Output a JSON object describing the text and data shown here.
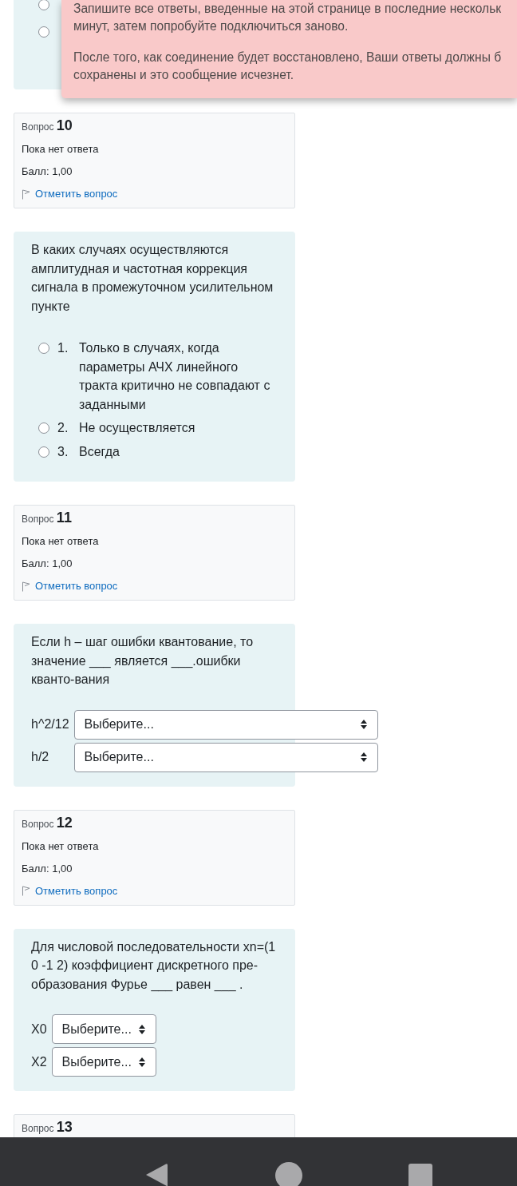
{
  "previous_question": {
    "options": [
      {
        "selected": false
      },
      {
        "selected": false
      }
    ]
  },
  "alert": {
    "paragraphs": [
      [
        "Запишите все ответы, введенные на этой странице в последние нескольк",
        "минут, затем попробуйте подключиться заново."
      ],
      [
        "После того, как соединение будет восстановлено, Ваши ответы должны б",
        "сохранены и это сообщение исчезнет."
      ]
    ]
  },
  "questions": [
    {
      "info": {
        "title": "Вопрос **10**",
        "status": "Пока нет ответа",
        "grade": "Балл: 1,00",
        "flag_link": "Отметить вопрос",
        "flagged": false
      },
      "content": {
        "kind": "multichoice",
        "text": "В каких случаях осуществляются амплитудная и частотная коррекция сигнала в промежуточном усилительном пункте",
        "options": [
          {
            "number": "1.",
            "text": "Только в случаях, когда параметры АЧХ линейного тракта критично не совпадают с заданными",
            "selected": false
          },
          {
            "number": "2.",
            "text": "Не осуществляется",
            "selected": false
          },
          {
            "number": "3.",
            "text": "Всегда",
            "selected": false
          }
        ]
      }
    },
    {
      "info": {
        "title": "Вопрос **11**",
        "status": "Пока нет ответа",
        "grade": "Балл: 1,00",
        "flag_link": "Отметить вопрос",
        "flagged": false
      },
      "content": {
        "kind": "match",
        "text": "Если h – шаг ошибки квантование, то значение ___ является ___.ошибки кванто-вания",
        "rows": [
          {
            "stem": "h^2/12",
            "value": "Выберите..."
          },
          {
            "stem": "h/2",
            "value": "Выберите..."
          }
        ]
      }
    },
    {
      "info": {
        "title": "Вопрос **12**",
        "status": "Пока нет ответа",
        "grade": "Балл: 1,00",
        "flag_link": "Отметить вопрос",
        "flagged": false
      },
      "content": {
        "kind": "match",
        "text": "Для числовой последовательности xn=(1 0 -1 2) коэффициент дискретного пре-образования Фурье ___ равен ___ .",
        "rows": [
          {
            "stem": "X0",
            "value": "Выберите..."
          },
          {
            "stem": "X2",
            "value": "Выберите..."
          }
        ]
      }
    },
    {
      "info": {
        "title": "Вопрос **13**"
      }
    }
  ]
}
